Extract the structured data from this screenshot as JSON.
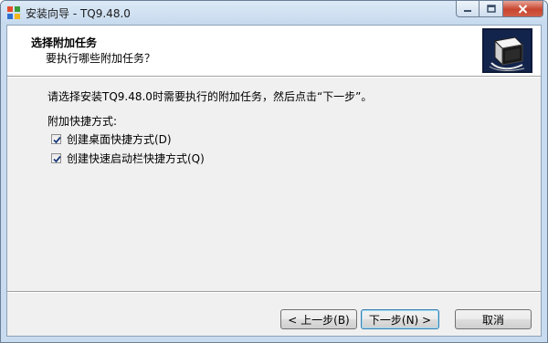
{
  "window": {
    "title": "安装向导 - TQ9.48.0"
  },
  "header": {
    "title": "选择附加任务",
    "subtitle": "要执行哪些附加任务？"
  },
  "body": {
    "description": "请选择安装TQ9.48.0时需要执行的附加任务，然后点击“下一步”。",
    "group_label": "附加快捷方式:",
    "tasks": [
      {
        "label": "创建桌面快捷方式(D)",
        "checked": true
      },
      {
        "label": "创建快速启动栏快捷方式(Q)",
        "checked": true
      }
    ]
  },
  "buttons": {
    "back": "< 上一步(B)",
    "next": "下一步(N) >",
    "cancel": "取消"
  },
  "colors": {
    "titlebar": "#c6daee",
    "client": "#f0f0f0",
    "close_button": "#c8452f",
    "default_button_border": "#3c7fb1"
  },
  "icons": {
    "app": "installer-app-icon",
    "header_image": "computer-box-icon",
    "minimize": "minimize-icon",
    "maximize": "maximize-icon",
    "close": "close-icon",
    "checkbox": "checkmark-icon"
  }
}
